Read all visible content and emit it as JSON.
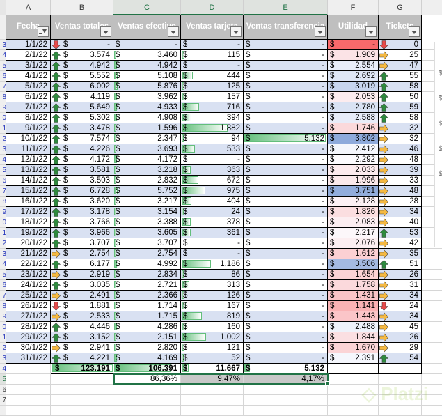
{
  "columns": [
    "A",
    "B",
    "C",
    "D",
    "E",
    "F",
    "G"
  ],
  "selected_columns": [
    "C",
    "D",
    "E"
  ],
  "headers": {
    "fecha": "Fecha",
    "ventas_totales": "Ventas totales",
    "ventas_efectivo": "Ventas efectivo",
    "ventas_tarjeta": "Ventas tarjeta",
    "ventas_transferencia": "Ventas transferencia",
    "utilidad": "Utilidad",
    "tickets": "Tickets"
  },
  "currency": "$",
  "icons": {
    "up": "green-up-arrow-icon",
    "right": "yellow-right-arrow-icon",
    "down": "red-down-arrow-icon",
    "filter_active": "filter-active-icon",
    "dropdown": "dropdown-icon"
  },
  "colors": {
    "band": "#d9e1f2",
    "header": "#bfbfbf",
    "databar": "#63be7b",
    "scale_low": "#f8696b",
    "scale_high": "#8eaadb",
    "selection": "#217346",
    "arrow_up": "#2e8b3e",
    "arrow_right": "#f5b942",
    "arrow_down": "#e84b4b"
  },
  "rows": [
    [
      "1/1/22",
      "down",
      "-",
      "-",
      "-",
      "-",
      "-",
      "down",
      "0"
    ],
    [
      "2/1/22",
      "up",
      "3.574",
      "3.460",
      "115",
      "-",
      "1.909",
      "right",
      "25"
    ],
    [
      "3/1/22",
      "up",
      "4.942",
      "4.942",
      "-",
      "-",
      "2.554",
      "right",
      "47"
    ],
    [
      "4/1/22",
      "up",
      "5.552",
      "5.108",
      "444",
      "-",
      "2.692",
      "up",
      "55"
    ],
    [
      "5/1/22",
      "up",
      "6.002",
      "5.876",
      "125",
      "-",
      "3.019",
      "up",
      "58"
    ],
    [
      "6/1/22",
      "up",
      "4.119",
      "3.962",
      "157",
      "-",
      "2.053",
      "up",
      "50"
    ],
    [
      "7/1/22",
      "up",
      "5.649",
      "4.933",
      "716",
      "-",
      "2.780",
      "up",
      "59"
    ],
    [
      "8/1/22",
      "up",
      "5.302",
      "4.908",
      "394",
      "-",
      "2.588",
      "up",
      "58"
    ],
    [
      "9/1/22",
      "up",
      "3.478",
      "1.596",
      "1.882",
      "-",
      "1.746",
      "right",
      "32"
    ],
    [
      "10/1/22",
      "up",
      "7.574",
      "2.347",
      "94",
      "5.132",
      "3.802",
      "right",
      "32"
    ],
    [
      "11/1/22",
      "up",
      "4.226",
      "3.693",
      "533",
      "-",
      "2.412",
      "right",
      "46"
    ],
    [
      "12/1/22",
      "up",
      "4.172",
      "4.172",
      "-",
      "-",
      "2.292",
      "right",
      "48"
    ],
    [
      "13/1/22",
      "up",
      "3.581",
      "3.218",
      "363",
      "-",
      "2.033",
      "right",
      "39"
    ],
    [
      "14/1/22",
      "up",
      "3.503",
      "2.832",
      "672",
      "-",
      "1.996",
      "right",
      "33"
    ],
    [
      "15/1/22",
      "up",
      "6.728",
      "5.752",
      "975",
      "-",
      "3.751",
      "right",
      "48"
    ],
    [
      "16/1/22",
      "up",
      "3.620",
      "3.217",
      "404",
      "-",
      "2.128",
      "right",
      "28"
    ],
    [
      "17/1/22",
      "up",
      "3.178",
      "3.154",
      "24",
      "-",
      "1.826",
      "right",
      "34"
    ],
    [
      "18/1/22",
      "up",
      "3.766",
      "3.388",
      "378",
      "-",
      "2.083",
      "right",
      "40"
    ],
    [
      "19/1/22",
      "up",
      "3.966",
      "3.605",
      "361",
      "-",
      "2.217",
      "up",
      "53"
    ],
    [
      "20/1/22",
      "up",
      "3.707",
      "3.707",
      "-",
      "-",
      "2.076",
      "right",
      "42"
    ],
    [
      "21/1/22",
      "right",
      "2.754",
      "2.754",
      "-",
      "-",
      "1.612",
      "right",
      "35"
    ],
    [
      "22/1/22",
      "up",
      "6.177",
      "4.992",
      "1.186",
      "-",
      "3.506",
      "up",
      "51"
    ],
    [
      "23/1/22",
      "right",
      "2.919",
      "2.834",
      "86",
      "-",
      "1.654",
      "right",
      "26"
    ],
    [
      "24/1/22",
      "up",
      "3.035",
      "2.721",
      "313",
      "-",
      "1.758",
      "right",
      "31"
    ],
    [
      "25/1/22",
      "right",
      "2.491",
      "2.366",
      "126",
      "-",
      "1.431",
      "right",
      "34"
    ],
    [
      "26/1/22",
      "down",
      "1.881",
      "1.714",
      "167",
      "-",
      "1.141",
      "down",
      "24"
    ],
    [
      "27/1/22",
      "right",
      "2.533",
      "1.715",
      "819",
      "-",
      "1.443",
      "right",
      "34"
    ],
    [
      "28/1/22",
      "up",
      "4.446",
      "4.286",
      "160",
      "-",
      "2.488",
      "right",
      "45"
    ],
    [
      "29/1/22",
      "up",
      "3.152",
      "2.151",
      "1.002",
      "-",
      "1.844",
      "right",
      "26"
    ],
    [
      "30/1/22",
      "right",
      "2.941",
      "2.820",
      "121",
      "-",
      "1.670",
      "right",
      "29"
    ],
    [
      "31/1/22",
      "up",
      "4.221",
      "4.169",
      "52",
      "-",
      "2.391",
      "up",
      "54"
    ]
  ],
  "totals": {
    "ventas_totales": "123.191",
    "ventas_efectivo": "106.391",
    "ventas_tarjeta": "11.667",
    "ventas_transferencia": "5.132"
  },
  "percentages": {
    "efectivo": "86,36%",
    "tarjeta": "9,47%",
    "transferencia": "4,17%"
  },
  "row_numbers": [
    "3",
    "4",
    "5",
    "6",
    "7",
    "8",
    "9",
    "0",
    "1",
    "2",
    "3",
    "4",
    "5",
    "6",
    "7",
    "8",
    "9",
    "0",
    "1",
    "2",
    "3",
    "4",
    "5",
    "6",
    "7",
    "8",
    "9",
    "0",
    "1",
    "2",
    "3",
    "4",
    "5",
    "6",
    "7"
  ],
  "side_panel_labels": [
    "$",
    "$",
    "$",
    "$",
    "$"
  ],
  "watermark": "Platzi"
}
